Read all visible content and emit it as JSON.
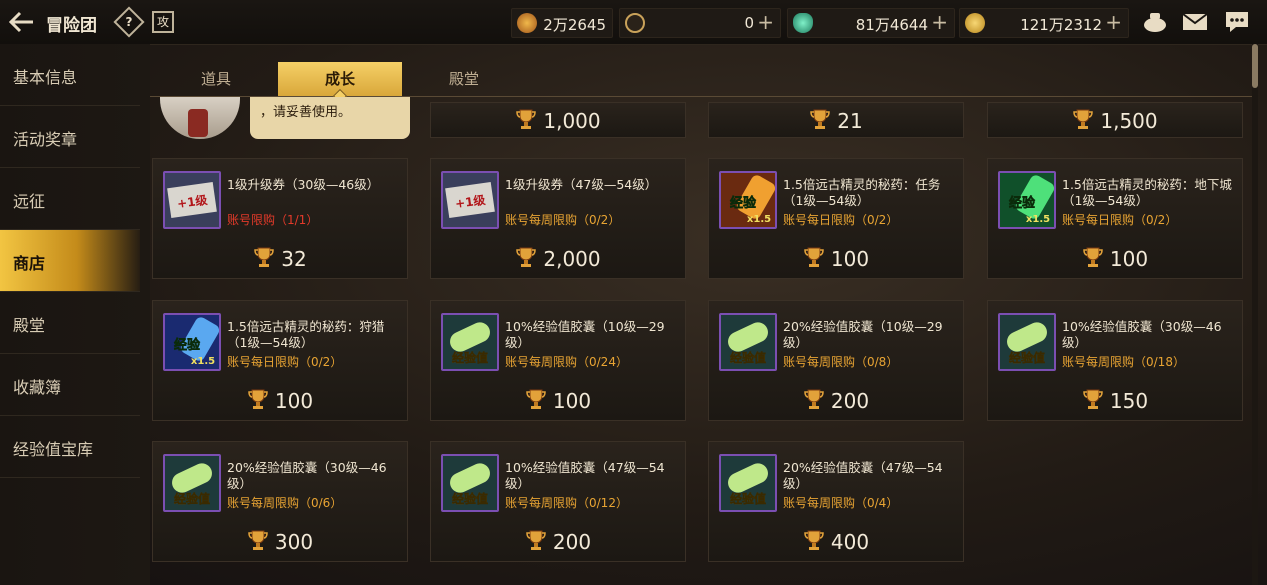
{
  "header": {
    "title": "冒险团",
    "help_glyph": "?",
    "guide_glyph": "攻"
  },
  "currencies": [
    {
      "value": "2万2645",
      "icon": "trophy-icon",
      "plus": false
    },
    {
      "value": "0",
      "icon": "cera-coin-icon",
      "plus": true
    },
    {
      "value": "81万4644",
      "icon": "green-crystal-icon",
      "plus": true
    },
    {
      "value": "121万2312",
      "icon": "gold-coin-icon",
      "plus": true
    }
  ],
  "plus_glyph": "+",
  "sidebar": {
    "items": [
      {
        "label": "基本信息"
      },
      {
        "label": "活动奖章"
      },
      {
        "label": "远征"
      },
      {
        "label": "商店",
        "active": true
      },
      {
        "label": "殿堂"
      },
      {
        "label": "收藏簿"
      },
      {
        "label": "经验值宝库"
      }
    ]
  },
  "tabs": [
    {
      "label": "道具"
    },
    {
      "label": "成长",
      "active": true
    },
    {
      "label": "殿堂"
    }
  ],
  "npc_text": "，请妥善使用。",
  "top_prices": [
    "1,000",
    "21",
    "1,500"
  ],
  "products": [
    {
      "name": "1级升级券（30级—46级）",
      "limit": "账号限购（1/1）",
      "limit_red": true,
      "price": "32",
      "thumb": "level-ticket"
    },
    {
      "name": "1级升级券（47级—54级）",
      "limit": "账号每周限购（0/2）",
      "price": "2,000",
      "thumb": "level-ticket"
    },
    {
      "name": "1.5倍远古精灵的秘药：任务（1级—54级）",
      "limit": "账号每日限购（0/2）",
      "price": "100",
      "thumb": "potion-orange"
    },
    {
      "name": "1.5倍远古精灵的秘药：地下城（1级—54级）",
      "limit": "账号每日限购（0/2）",
      "price": "100",
      "thumb": "potion-green"
    },
    {
      "name": "1.5倍远古精灵的秘药：狩猎（1级—54级）",
      "limit": "账号每日限购（0/2）",
      "price": "100",
      "thumb": "potion-blue"
    },
    {
      "name": "10%经验值胶囊（10级—29级）",
      "limit": "账号每周限购（0/24）",
      "price": "100",
      "thumb": "exp-capsule"
    },
    {
      "name": "20%经验值胶囊（10级—29级）",
      "limit": "账号每周限购（0/8）",
      "price": "200",
      "thumb": "exp-capsule"
    },
    {
      "name": "10%经验值胶囊（30级—46级）",
      "limit": "账号每周限购（0/18）",
      "price": "150",
      "thumb": "exp-capsule"
    },
    {
      "name": "20%经验值胶囊（30级—46级）",
      "limit": "账号每周限购（0/6）",
      "price": "300",
      "thumb": "exp-capsule"
    },
    {
      "name": "10%经验值胶囊（47级—54级）",
      "limit": "账号每周限购（0/12）",
      "price": "200",
      "thumb": "exp-capsule"
    },
    {
      "name": "20%经验值胶囊（47级—54级）",
      "limit": "账号每周限购（0/4）",
      "price": "400",
      "thumb": "exp-capsule"
    }
  ],
  "thumb_labels": {
    "ticket": "+1级",
    "potion_line1": "经验",
    "potion_line2": "x1.5",
    "capsule": "经验值"
  },
  "colors": {
    "accent_gold": "#f2c542",
    "limit_orange": "#e8a433",
    "limit_red": "#e33a2a",
    "rarity_purple": "#7b4fb2"
  }
}
